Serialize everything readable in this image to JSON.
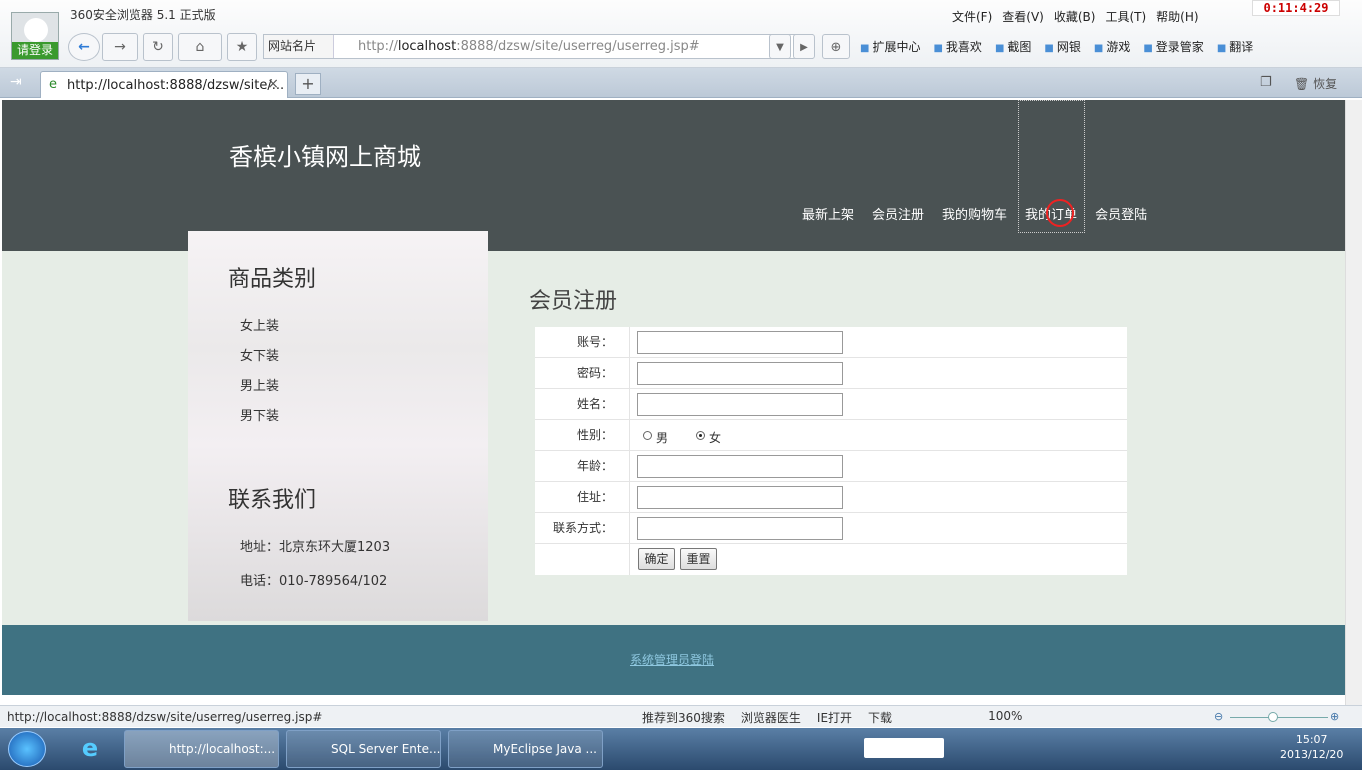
{
  "browser": {
    "app_title": "360安全浏览器 5.1 正式版",
    "login_label": "请登录",
    "menu": [
      "文件(F)",
      "查看(V)",
      "收藏(B)",
      "工具(T)",
      "帮助(H)"
    ],
    "clock": "0:11:4:29",
    "site_card": "网站名片",
    "url_host": "localhost",
    "url_prefix": "http://",
    "url_rest": ":8888/dzsw/site/userreg/userreg.jsp#",
    "toolbar": [
      "扩展中心",
      "我喜欢",
      "截图",
      "网银",
      "游戏",
      "登录管家",
      "翻译"
    ],
    "tab_title": "http://localhost:8888/dzsw/site/...",
    "restore_label": "恢复",
    "status_url": "http://localhost:8888/dzsw/site/userreg/userreg.jsp#",
    "status_tools": [
      "推荐到360搜索",
      "浏览器医生",
      "IE打开",
      "下载",
      "100%"
    ]
  },
  "site": {
    "logo": "香槟小镇网上商城",
    "nav": [
      "最新上架",
      "会员注册",
      "我的购物车",
      "我的订单",
      "会员登陆"
    ],
    "sidebar": {
      "categories_title": "商品类别",
      "categories": [
        "女上装",
        "女下装",
        "男上装",
        "男下装"
      ],
      "contact_title": "联系我们",
      "address": "地址：北京东环大厦1203",
      "phone": "电话：010-789564/102"
    },
    "form": {
      "title": "会员注册",
      "fields": [
        "账号：",
        "密码：",
        "姓名：",
        "性别：",
        "年龄：",
        "住址：",
        "联系方式："
      ],
      "gender_male": "男",
      "gender_female": "女",
      "gender_selected": "女",
      "submit": "确定",
      "reset": "重置"
    },
    "footer_link": "系统管理员登陆"
  },
  "taskbar": {
    "tasks": [
      "http://localhost:...",
      "SQL Server Ente...",
      "MyEclipse Java ..."
    ],
    "time": "15:07",
    "date": "2013/12/20"
  }
}
